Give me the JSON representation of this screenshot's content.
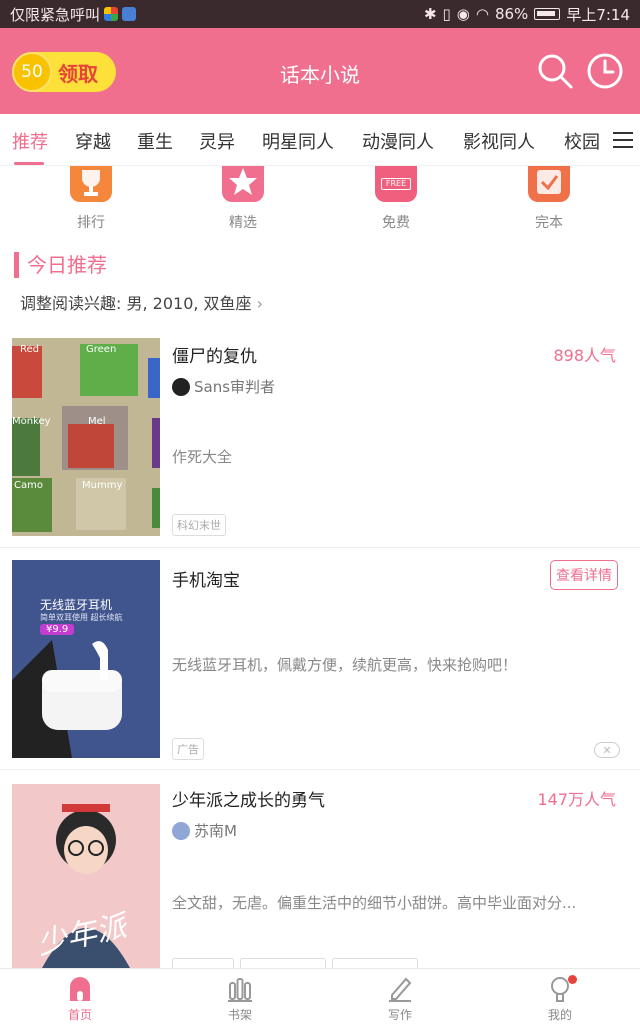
{
  "status_bar": {
    "carrier_text": "仅限紧急呼叫",
    "battery": "86%",
    "time": "早上7:14"
  },
  "header": {
    "coin_amount": "50",
    "coin_label": "领取",
    "title": "话本小说",
    "accent_color": "#f06e8e"
  },
  "tabs": [
    {
      "label": "推荐",
      "active": true
    },
    {
      "label": "穿越"
    },
    {
      "label": "重生"
    },
    {
      "label": "灵异"
    },
    {
      "label": "明星同人"
    },
    {
      "label": "动漫同人"
    },
    {
      "label": "影视同人"
    },
    {
      "label": "校园"
    }
  ],
  "categories": [
    {
      "label": "排行",
      "icon": "trophy-icon",
      "color": "#f5873d"
    },
    {
      "label": "精选",
      "icon": "star-icon",
      "color": "#f06e8e"
    },
    {
      "label": "免费",
      "icon": "free-icon",
      "color": "#f0607e",
      "badge": "FREE"
    },
    {
      "label": "完本",
      "icon": "check-icon",
      "color": "#f0704a"
    }
  ],
  "section": {
    "title": "今日推荐",
    "interest_text": "调整阅读兴趣: 男, 2010, 双鱼座"
  },
  "books": [
    {
      "title": "僵尸的复仇",
      "metric": "898人气",
      "author": "Sans审判者",
      "synopsis": "作死大全",
      "tags": [
        "科幻末世"
      ]
    }
  ],
  "ad": {
    "title": "手机淘宝",
    "detail_label": "查看详情",
    "synopsis": "无线蓝牙耳机，佩戴方便，续航更高，快来抢购吧！",
    "ad_tag": "广告",
    "cover_headline": "无线蓝牙耳机",
    "cover_sub": "简单双耳使用 超长续航",
    "cover_price": "¥9.9"
  },
  "books2": [
    {
      "title": "少年派之成长的勇气",
      "metric": "147万人气",
      "author": "苏南M",
      "synopsis": "全文甜，无虐。偏重生活中的细节小甜饼。高中毕业面对分...",
      "cover_text": "少年派"
    }
  ],
  "cover1_blocks": [
    "Red",
    "Green",
    "Monkey",
    "Mel",
    "Camo",
    "Mummy"
  ],
  "bottom_nav": [
    {
      "label": "首页",
      "icon": "home-icon",
      "active": true
    },
    {
      "label": "书架",
      "icon": "bookshelf-icon"
    },
    {
      "label": "写作",
      "icon": "write-icon"
    },
    {
      "label": "我的",
      "icon": "profile-icon",
      "badge": true
    }
  ]
}
